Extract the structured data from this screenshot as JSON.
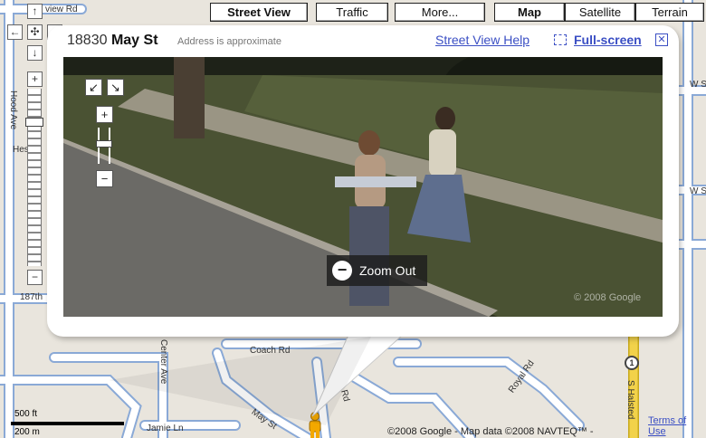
{
  "top_buttons": {
    "street_view": "Street View",
    "traffic": "Traffic",
    "more": "More...",
    "map": "Map",
    "satellite": "Satellite",
    "terrain": "Terrain"
  },
  "map_labels": {
    "view_rd": "view Rd",
    "hood_ave": "Hood Ave",
    "hes": "Hes",
    "street_187th": "187th",
    "coach_rd": "Coach Rd",
    "center_ave": "Center Ave",
    "may_st": "May St",
    "dixie_rd": "D  a Rd",
    "royal_rd": "Royal Rd",
    "s_halsted": "S Halsted",
    "jamie_ln": "Jamie Ln",
    "w_s1": "W S",
    "w_s2": "W S",
    "route_1": "1"
  },
  "scale": {
    "ft": "500 ft",
    "m": "200 m"
  },
  "infowindow": {
    "number": "18830",
    "street": "May St",
    "approx": "Address is approximate",
    "help": "Street View Help",
    "fullscreen": "Full-screen",
    "close_glyph": "✕"
  },
  "streetview": {
    "zoom_tip": "Zoom Out",
    "copyright": "© 2008 Google"
  },
  "footer": {
    "data": "©2008 Google - Map data ©2008 NAVTEQ™ -",
    "terms": "Terms of Use"
  },
  "icons": {
    "pan_up": "arrow-up-icon",
    "pan_left": "arrow-left-icon",
    "pan_right": "arrow-right-icon",
    "pan_down": "arrow-down-icon",
    "center": "center-icon",
    "zoom_in": "plus-icon",
    "zoom_out": "minus-icon",
    "fullscreen": "fullscreen-icon",
    "close": "close-icon",
    "pegman": "pegman-icon"
  },
  "colors": {
    "road_fill": "#ffffff",
    "road_edge": "#8aa9d6",
    "highway": "#f2d24a",
    "link": "#3b4fc4"
  }
}
